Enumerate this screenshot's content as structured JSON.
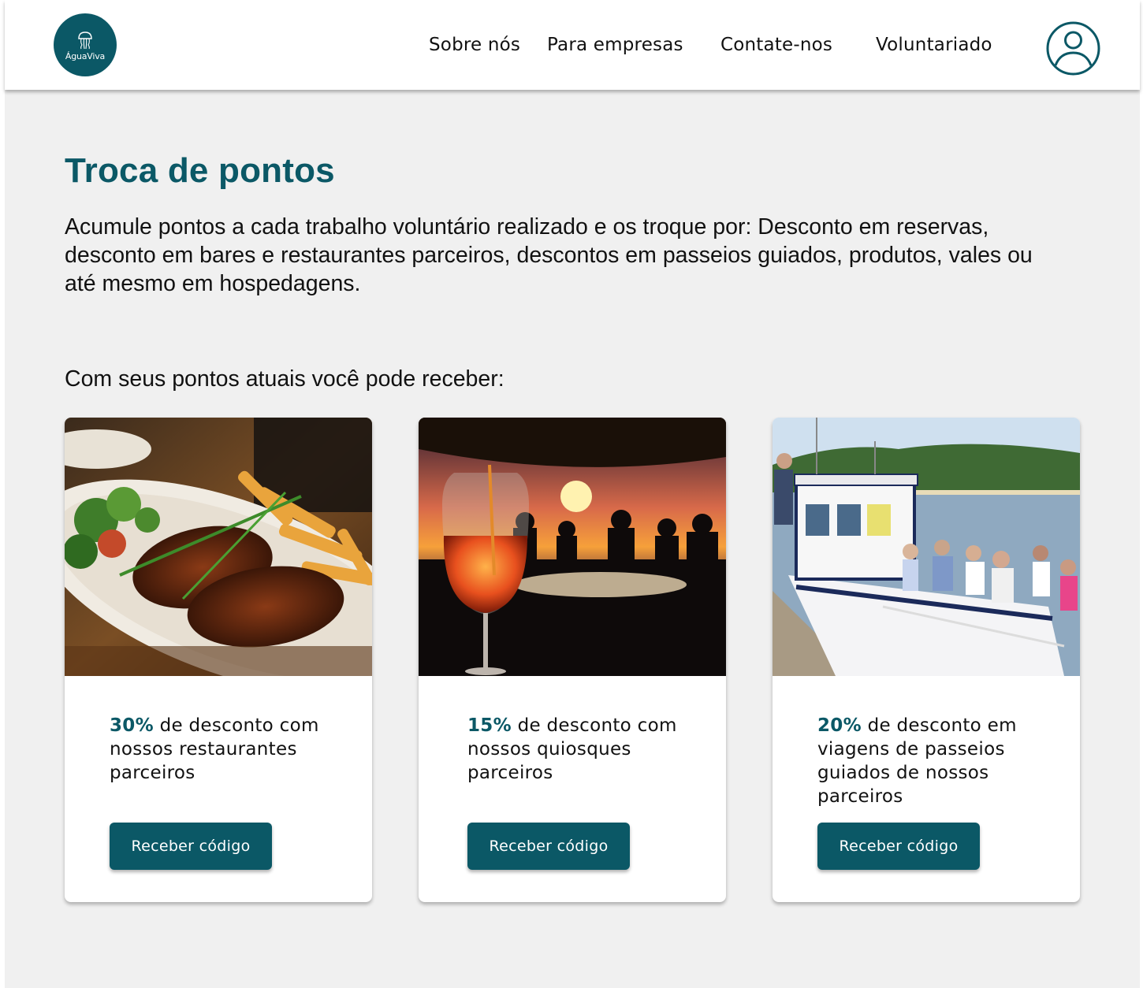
{
  "header": {
    "logo_text": "ÁguaViva",
    "nav": [
      "Sobre nós",
      "Para empresas",
      "Contate-nos",
      "Voluntariado"
    ],
    "profile_icon": "user-icon"
  },
  "main": {
    "title": "Troca de pontos",
    "intro": "Acumule pontos a cada trabalho voluntário realizado e os troque por: Desconto em reservas, desconto em bares e restaurantes parceiros, descontos em passeios guiados, produtos, vales ou até mesmo em hospedagens.",
    "subheading": "Com seus pontos atuais você pode receber:"
  },
  "cards": [
    {
      "image": "grilled-steak-with-fries-photo",
      "discount": "30%",
      "description": " de desconto com nossos restaurantes parceiros",
      "button": "Receber código"
    },
    {
      "image": "cocktail-at-sunset-photo",
      "discount": "15%",
      "description": " de desconto com nossos quiosques parceiros",
      "button": "Receber código"
    },
    {
      "image": "boat-tour-passengers-photo",
      "discount": "20%",
      "description": " de desconto em viagens de passeios guiados de nossos parceiros",
      "button": "Receber código"
    }
  ],
  "colors": {
    "brand": "#0b5866",
    "background": "#f0f0f0",
    "card": "#ffffff"
  }
}
